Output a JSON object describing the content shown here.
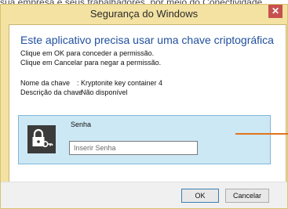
{
  "background": {
    "top_text": "sua empresa e seus trabalhadores, por meio do Conectividade",
    "side_marks": [
      "r",
      "-",
      "'C"
    ]
  },
  "window": {
    "title": "Segurança do Windows",
    "close_label": "✕"
  },
  "dialog": {
    "heading": "Este aplicativo precisa usar uma chave criptográfica",
    "instruction_ok": "Clique em OK para conceder a permissão.",
    "instruction_cancel": "Clique em Cancelar para negar a permissão.",
    "key_name_label": "Nome da chave",
    "key_name_value": ": Kryptonite key container 4",
    "key_desc_label": "Descrição da chave",
    "key_desc_value": ": Não disponível"
  },
  "credential": {
    "label": "Senha",
    "placeholder": "Inserir Senha",
    "value": ""
  },
  "buttons": {
    "ok": "OK",
    "cancel": "Cancelar"
  },
  "colors": {
    "frame": "#f3e2a2",
    "heading": "#1f4f9e",
    "tile_bg": "#cde8f5",
    "close": "#c75050",
    "annotation": "#e2731c"
  },
  "icons": {
    "key_tile": "lock-key-icon",
    "close": "close-icon"
  }
}
